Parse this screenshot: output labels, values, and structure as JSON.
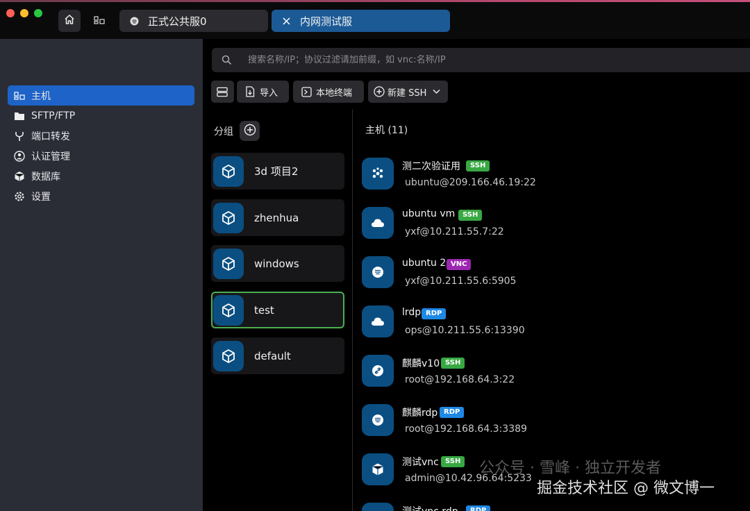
{
  "tabs": [
    {
      "label": "正式公共服0"
    },
    {
      "label": "内网测试服"
    }
  ],
  "sidebar": {
    "items": [
      {
        "label": "主机",
        "icon": "hosts-icon"
      },
      {
        "label": "SFTP/FTP",
        "icon": "folder-icon"
      },
      {
        "label": "端口转发",
        "icon": "fork-icon"
      },
      {
        "label": "认证管理",
        "icon": "user-lock-icon"
      },
      {
        "label": "数据库",
        "icon": "cube-icon"
      },
      {
        "label": "设置",
        "icon": "gear-icon"
      }
    ]
  },
  "search": {
    "placeholder": "搜索名称/IP；协议过滤请加前缀，如 vnc:名称/IP"
  },
  "toolbar": {
    "import_label": "导入",
    "local_terminal_label": "本地终端",
    "new_ssh_label": "新建 SSH"
  },
  "groups": {
    "title": "分组",
    "items": [
      {
        "label": "3d 项目2"
      },
      {
        "label": "zhenhua"
      },
      {
        "label": "windows"
      },
      {
        "label": "test"
      },
      {
        "label": "default"
      }
    ]
  },
  "hosts": {
    "title": "主机 (11)",
    "items": [
      {
        "name": "测二次验证用",
        "protocol": "SSH",
        "address": "ubuntu@209.166.46.19:22",
        "icon": "cluster-icon"
      },
      {
        "name": "ubuntu vm",
        "protocol": "SSH",
        "address": "yxf@10.211.55.7:22",
        "icon": "cloud-icon"
      },
      {
        "name": "ubuntu 2",
        "protocol": "VNC",
        "address": "yxf@10.211.55.6:5905",
        "icon": "server-icon"
      },
      {
        "name": "lrdp",
        "protocol": "RDP",
        "address": "ops@10.211.55.6:13390",
        "icon": "cloud-icon"
      },
      {
        "name": "麒麟v10",
        "protocol": "SSH",
        "address": "root@192.168.64.3:22",
        "icon": "link-icon"
      },
      {
        "name": "麒麟rdp",
        "protocol": "RDP",
        "address": "root@192.168.64.3:3389",
        "icon": "server-icon"
      },
      {
        "name": "测试vnc",
        "protocol": "SSH",
        "address": "admin@10.42.96.64:5233",
        "icon": "cube-icon"
      },
      {
        "name": "测试vnc rdp",
        "protocol": "RDP",
        "address": "",
        "icon": "cube-icon"
      }
    ]
  },
  "watermark": {
    "faint": "公众号 · 雪峰 · 独立开发者",
    "main": "掘金技术社区 @ 微文博一"
  },
  "colors": {
    "accent": "#1e63c7",
    "ssh": "#38a843",
    "vnc": "#9c27b0",
    "rdp": "#1e88e5",
    "selected_border": "#4caf50"
  }
}
